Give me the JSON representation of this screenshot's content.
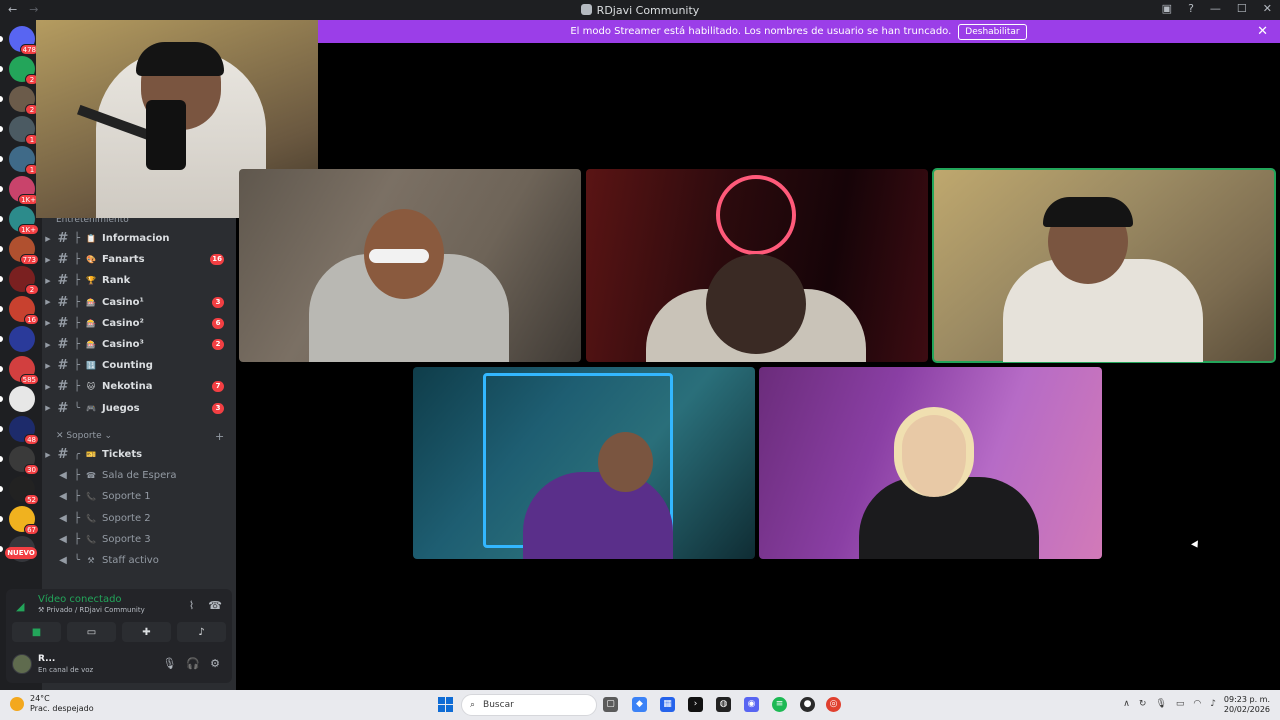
{
  "window": {
    "title": "RDjavi Community"
  },
  "banner": {
    "text": "El modo Streamer está habilitado. Los nombres de usuario se han truncado.",
    "button": "Deshabilitar"
  },
  "servers": [
    {
      "badge": "478",
      "color": "#5865f2"
    },
    {
      "badge": "2",
      "color": "#23a55a"
    },
    {
      "badge": "2",
      "color": "#6b5b4a"
    },
    {
      "badge": "1",
      "color": "#4b5a62"
    },
    {
      "badge": "1",
      "color": "#3f6a88"
    },
    {
      "badge": "1K+",
      "color": "#c9436b"
    },
    {
      "badge": "1K+",
      "color": "#2c8b8b"
    },
    {
      "badge": "773",
      "color": "#b0502f"
    },
    {
      "badge": "2",
      "color": "#7a2020"
    },
    {
      "badge": "16",
      "color": "#c8412f"
    },
    {
      "badge": "",
      "color": "#2a3a9a"
    },
    {
      "badge": "585",
      "color": "#d23f3f"
    },
    {
      "badge": "",
      "color": "#e7e7e7"
    },
    {
      "badge": "48",
      "color": "#1d2b6b"
    },
    {
      "badge": "30",
      "color": "#3a3a3a"
    },
    {
      "badge": "52",
      "color": "#222222"
    },
    {
      "badge": "67",
      "color": "#f0b21f"
    },
    {
      "badge": "",
      "color": "#35373c"
    }
  ],
  "new_label": "NUEVO",
  "categories": {
    "entretenimiento": "Entretenimiento",
    "soporte": "Soporte"
  },
  "channels": [
    {
      "name": "Informacion",
      "emoji": "📋",
      "badge": ""
    },
    {
      "name": "Fanarts",
      "emoji": "🎨",
      "badge": "16"
    },
    {
      "name": "Rank",
      "emoji": "🏆",
      "badge": ""
    },
    {
      "name": "Casino¹",
      "emoji": "🎰",
      "badge": "3"
    },
    {
      "name": "Casino²",
      "emoji": "🎰",
      "badge": "6"
    },
    {
      "name": "Casino³",
      "emoji": "🎰",
      "badge": "2"
    },
    {
      "name": "Counting",
      "emoji": "🔢",
      "badge": ""
    },
    {
      "name": "Nekotina",
      "emoji": "🐱",
      "badge": "7"
    },
    {
      "name": "Juegos",
      "emoji": "🎮",
      "badge": "3"
    }
  ],
  "support_channels": [
    {
      "name": "Tickets",
      "emoji": "🎫",
      "voice": false
    },
    {
      "name": "Sala de Espera",
      "emoji": "☎",
      "voice": true
    },
    {
      "name": "Soporte 1",
      "emoji": "📞",
      "voice": true
    },
    {
      "name": "Soporte 2",
      "emoji": "📞",
      "voice": true
    },
    {
      "name": "Soporte 3",
      "emoji": "📞",
      "voice": true
    },
    {
      "name": "Staff activo",
      "emoji": "⚒",
      "voice": true
    }
  ],
  "voice": {
    "status": "Vídeo conectado",
    "channel": "Privado / RDjavi Community"
  },
  "user": {
    "name": "R...",
    "status": "En canal de voz"
  },
  "taskbar": {
    "temperature": "24°C",
    "weather": "Prac. despejado",
    "search": "Buscar",
    "time": "09:23 p. m.",
    "date": "20/02/2026"
  }
}
